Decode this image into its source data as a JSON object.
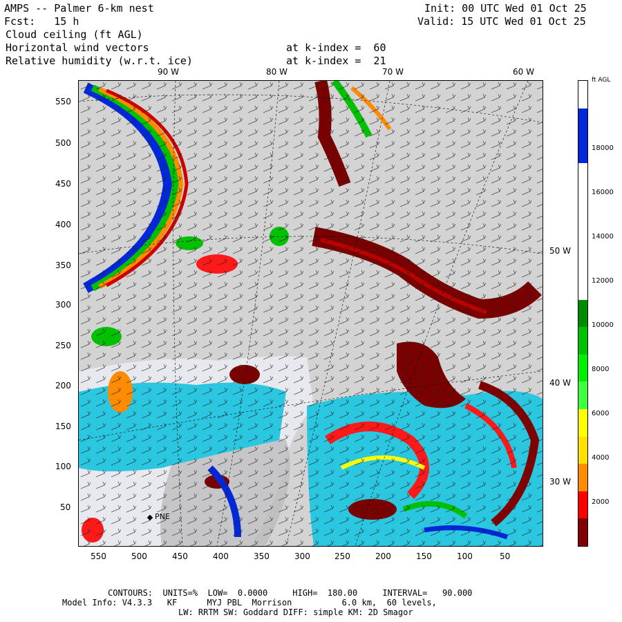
{
  "header": {
    "title": "AMPS -- Palmer 6-km nest",
    "fcst": "Fcst:   15 h",
    "init": "Init: 00 UTC Wed 01 Oct 25",
    "valid": "Valid: 15 UTC Wed 01 Oct 25",
    "field1": "Cloud ceiling (ft AGL)",
    "field2": "Horizontal wind vectors",
    "field2_level": "at k-index =  60",
    "field3": "Relative humidity (w.r.t. ice)",
    "field3_level": "at k-index =  21"
  },
  "axes": {
    "lon_top": [
      "90 W",
      "80 W",
      "70 W",
      "60 W"
    ],
    "lon_right": [
      "50 W",
      "40 W",
      "30 W"
    ],
    "y_ticks": [
      "550",
      "500",
      "450",
      "400",
      "350",
      "300",
      "250",
      "200",
      "150",
      "100",
      "50"
    ],
    "x_ticks": [
      "550",
      "500",
      "450",
      "400",
      "350",
      "300",
      "250",
      "200",
      "150",
      "100",
      "50"
    ]
  },
  "station": {
    "label": "PNE"
  },
  "colorbar": {
    "unit": "ft AGL",
    "labels": [
      "18000",
      "16000",
      "14000",
      "12000",
      "10000",
      "8000",
      "6000",
      "4000",
      "2000"
    ],
    "segments": [
      "#ffffff",
      "#0028d8",
      "#0028d8",
      "#ffffff",
      "#ffffff",
      "#ffffff",
      "#ffffff",
      "#ffffff",
      "#008c00",
      "#00c000",
      "#00f000",
      "#40ff40",
      "#ffff00",
      "#ffe000",
      "#ff8c00",
      "#ff0000",
      "#800000"
    ]
  },
  "footer": {
    "line1": "CONTOURS:  UNITS=%  LOW=  0.0000     HIGH=  180.00     INTERVAL=   90.000",
    "line2": "Model Info: V4.3.3   KF      MYJ PBL  Morrison          6.0 km,  60 levels,",
    "line3": "LW: RRTM SW: Goddard DIFF: simple KM: 2D Smagor"
  }
}
